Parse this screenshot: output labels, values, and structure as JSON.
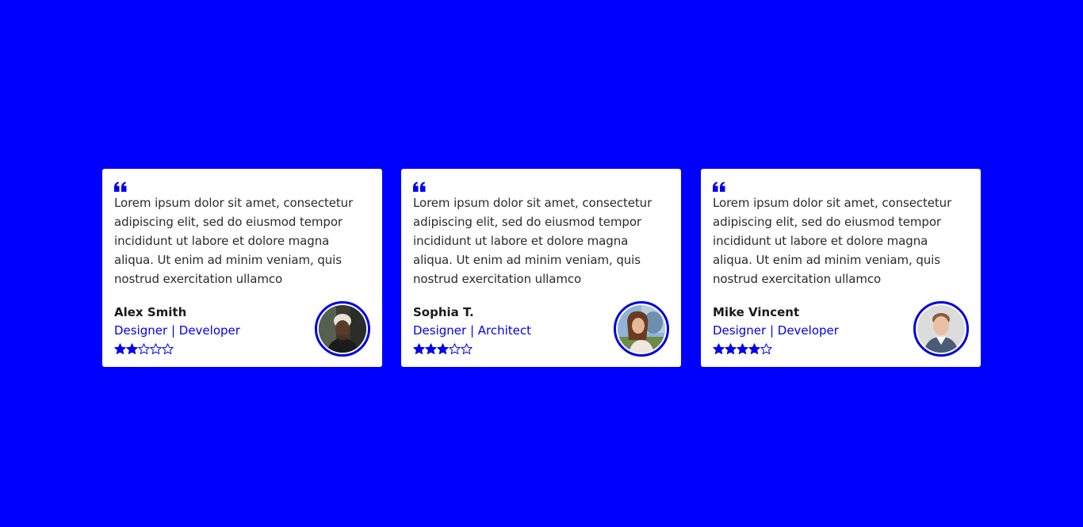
{
  "colors": {
    "background": "#0000ff",
    "card": "#ffffff",
    "accent": "#0000ee",
    "text": "#2b2b2b"
  },
  "testimonials": [
    {
      "quote": "Lorem ipsum dolor sit amet, consectetur adipiscing elit, sed do eiusmod tempor incididunt ut labore et dolore magna aliqua. Ut enim ad minim veniam, quis nostrud exercitation ullamco",
      "name": "Alex Smith",
      "role": "Designer | Developer",
      "rating": 2,
      "max_rating": 5,
      "avatar": "avatar-photo-man-dark-background"
    },
    {
      "quote": "Lorem ipsum dolor sit amet, consectetur adipiscing elit, sed do eiusmod tempor incididunt ut labore et dolore magna aliqua. Ut enim ad minim veniam, quis nostrud exercitation ullamco",
      "name": "Sophia T.",
      "role": "Designer | Architect",
      "rating": 3,
      "max_rating": 5,
      "avatar": "avatar-photo-woman-outdoor"
    },
    {
      "quote": "Lorem ipsum dolor sit amet, consectetur adipiscing elit, sed do eiusmod tempor incididunt ut labore et dolore magna aliqua. Ut enim ad minim veniam, quis nostrud exercitation ullamco",
      "name": "Mike Vincent",
      "role": "Designer | Developer",
      "rating": 4,
      "max_rating": 5,
      "avatar": "avatar-photo-man-light-background"
    }
  ],
  "icons": {
    "quote": "quote-icon",
    "star_filled": "star-filled-icon",
    "star_empty": "star-empty-icon"
  }
}
